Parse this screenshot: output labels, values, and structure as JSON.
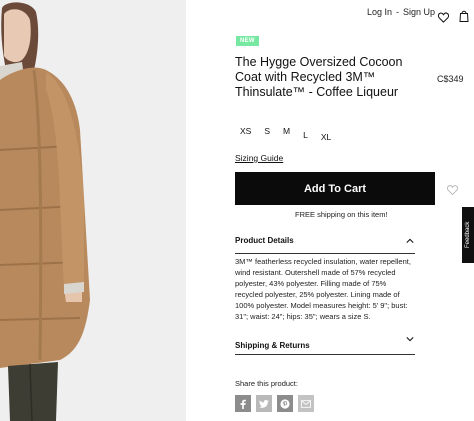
{
  "header": {
    "login_label": "Log In",
    "divider": "-",
    "signup_label": "Sign Up",
    "icons": [
      "heart-icon",
      "shopping-bag-icon"
    ]
  },
  "product": {
    "badge": "NEW",
    "title": "The Hygge Oversized Cocoon Coat with Recycled 3M™ Thinsulate™ - Coffee Liqueur",
    "price": "C$349",
    "sizes": [
      "XS",
      "S",
      "M",
      "L",
      "XL"
    ],
    "sizing_guide_label": "Sizing Guide",
    "add_to_cart_label": "Add To Cart",
    "free_shipping": "FREE shipping on this item!",
    "details_heading": "Product Details",
    "details_text": "3M™ featherless recycled insulation, water repellent, wind resistant. Outershell made of 57% recycled polyester, 43% polyester. Filling made of 75% recycled polyester, 25% polyester. Lining made of 100% polyester. Model measures height: 5' 9\"; bust: 31\"; waist: 24\"; hips: 35\"; wears a size S.",
    "shipping_heading": "Shipping & Returns",
    "share_label": "Share this product:",
    "share_icons": [
      "facebook-icon",
      "twitter-icon",
      "pinterest-icon",
      "email-icon"
    ]
  },
  "feedback": {
    "label": "Feedback"
  },
  "colors": {
    "badge": "#77e8a2",
    "button": "#0b0b0b",
    "coat": "#b8895c"
  }
}
